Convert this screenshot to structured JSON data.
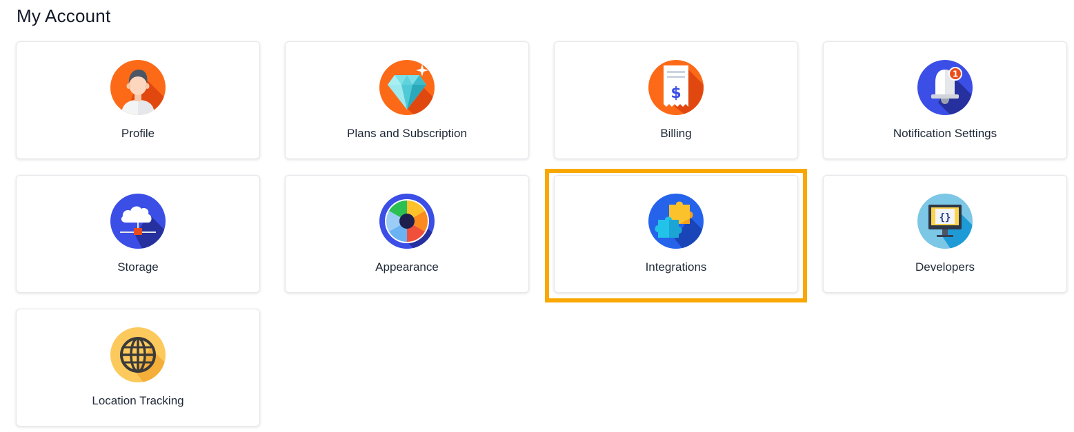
{
  "page": {
    "title": "My Account"
  },
  "cards": [
    {
      "label": "Profile",
      "icon": "profile-icon"
    },
    {
      "label": "Plans and Subscription",
      "icon": "diamond-icon"
    },
    {
      "label": "Billing",
      "icon": "receipt-icon"
    },
    {
      "label": "Notification Settings",
      "icon": "bell-icon"
    },
    {
      "label": "Storage",
      "icon": "cloud-storage-icon"
    },
    {
      "label": "Appearance",
      "icon": "color-wheel-icon"
    },
    {
      "label": "Integrations",
      "icon": "puzzle-icon"
    },
    {
      "label": "Developers",
      "icon": "code-monitor-icon"
    },
    {
      "label": "Location Tracking",
      "icon": "globe-icon"
    }
  ],
  "highlighted_card": "Integrations",
  "notification_badge": "1",
  "colors": {
    "highlight": "#f8a800",
    "orange": "#fd6a17",
    "blue": "#3b4ee6",
    "light_blue": "#7cc6e6",
    "yellow": "#fcc95c"
  }
}
